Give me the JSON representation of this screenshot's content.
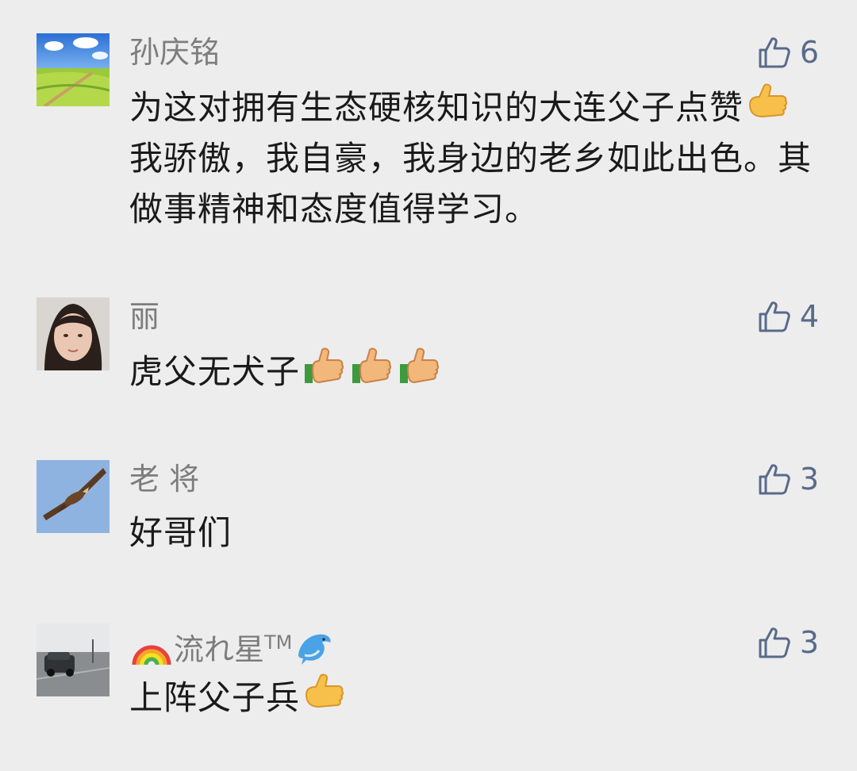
{
  "comments": [
    {
      "author": "孙庆铭",
      "likes": "6",
      "body_part1": "为这对拥有生态硬核知识的大连父子点赞",
      "body_part2": "我骄傲，我自豪，我身边的老乡如此出色。其做事精神和态度值得学习。",
      "avatar_icon": "landscape-avatar-icon",
      "emoji": "thumbs-up-icon"
    },
    {
      "author": "丽",
      "likes": "4",
      "body_part1": "虎父无犬子",
      "avatar_icon": "portrait-avatar-icon",
      "emoji": "thumbs-up-icon",
      "emoji_count": 3
    },
    {
      "author": "老 将",
      "likes": "3",
      "body_part1": "好哥们",
      "avatar_icon": "eagle-avatar-icon"
    },
    {
      "author_prefix_icon": "rainbow-icon",
      "author": "流れ星",
      "author_tm": "TM",
      "author_suffix_icon": "dolphin-icon",
      "likes": "3",
      "body_part1": "上阵父子兵",
      "avatar_icon": "street-avatar-icon",
      "emoji": "thumbs-up-icon"
    }
  ],
  "colors": {
    "background": "#ededed",
    "author": "#7d7d7d",
    "body": "#1a1a1a",
    "like": "#596a8a"
  }
}
